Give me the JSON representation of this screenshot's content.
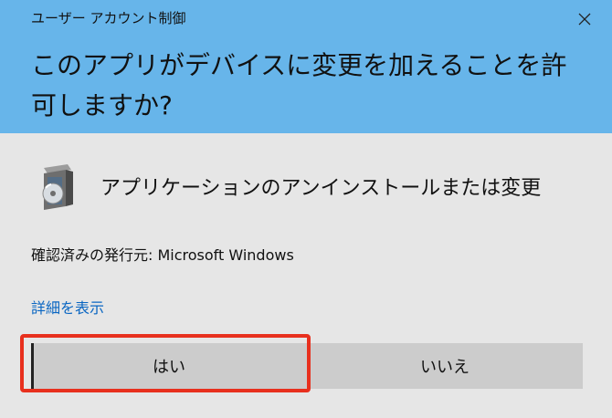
{
  "dialog": {
    "window_title": "ユーザー アカウント制御",
    "close_icon": "close-icon",
    "question": "このアプリがデバイスに変更を加えることを許可しますか?",
    "app_icon": "installer-cd-box-icon",
    "app_name": "アプリケーションのアンインストールまたは変更",
    "publisher": "確認済みの発行元: Microsoft Windows",
    "details_link": "詳細を表示",
    "yes_label": "はい",
    "no_label": "いいえ"
  },
  "colors": {
    "header": "#67b5ea",
    "body": "#e6e6e6",
    "button": "#cccccc",
    "link": "#0a66c2",
    "highlight": "#e8301e"
  }
}
